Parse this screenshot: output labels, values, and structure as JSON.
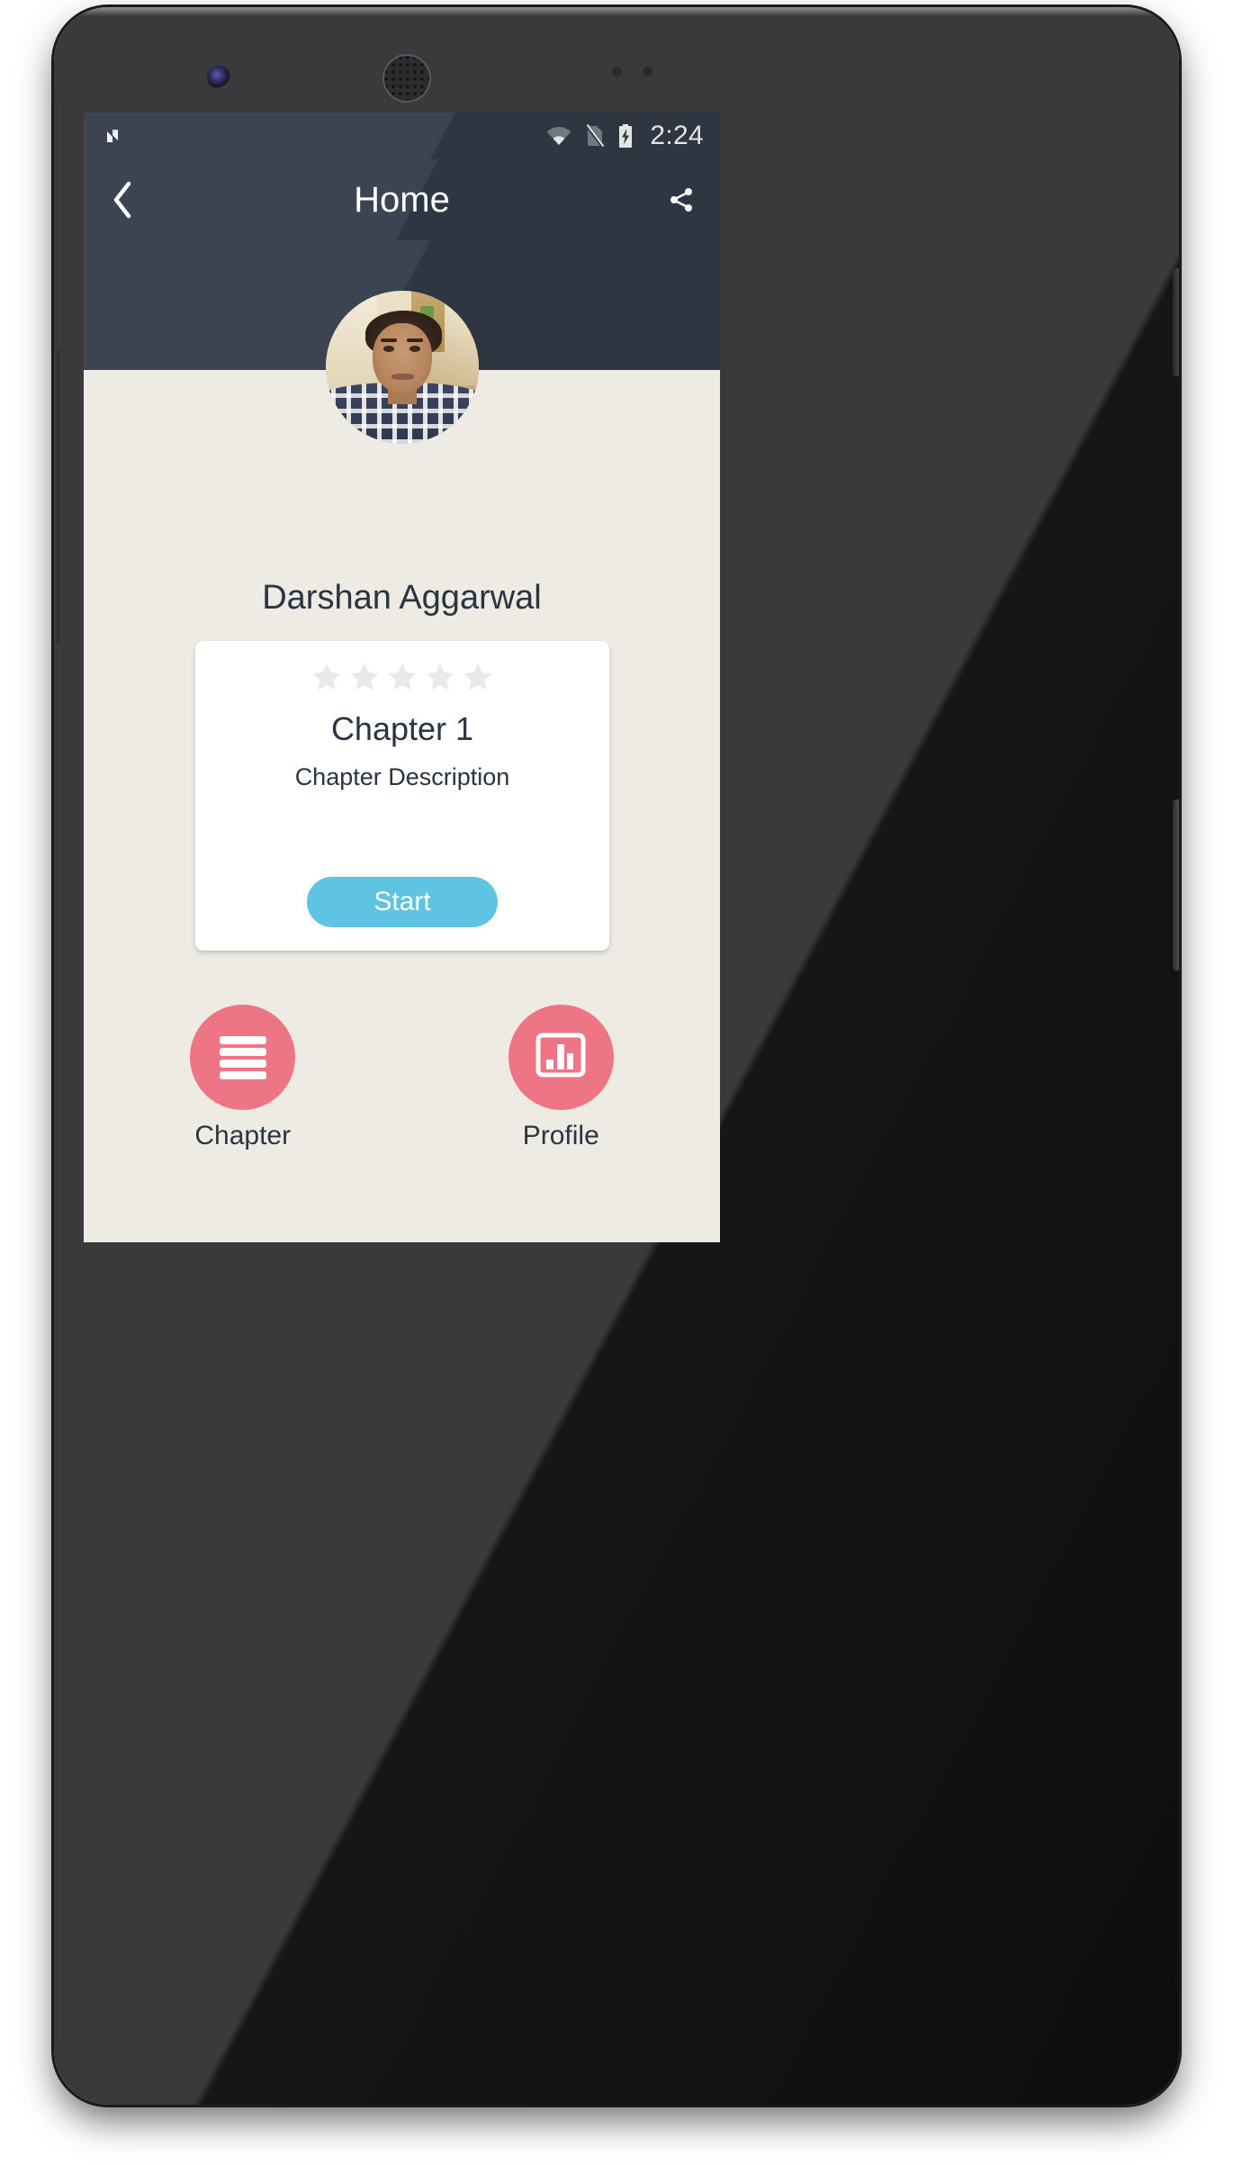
{
  "device": {
    "mockup_name": "android-phone-mockup",
    "camera_icon": "front-camera-icon",
    "speaker_icon": "earpiece-speaker-icon"
  },
  "status_bar": {
    "logo_icon": "android-n-logo-icon",
    "wifi_icon": "wifi-icon",
    "nosim_icon": "no-sim-icon",
    "battery_icon": "battery-charging-icon",
    "time": "2:24",
    "background_color": "#323C48"
  },
  "app_bar": {
    "back_icon": "chevron-left-icon",
    "title": "Home",
    "share_icon": "share-icon",
    "background_color": "#323C48",
    "title_color": "#FFFFFF"
  },
  "profile": {
    "avatar_icon": "user-avatar-photo",
    "name": "Darshan Aggarwal",
    "name_color": "#2B3441"
  },
  "chapter_card": {
    "rating": {
      "max": 5,
      "filled": 0,
      "star_icon": "star-icon",
      "empty_color": "#E9E9E9",
      "filled_color": "#FFC107"
    },
    "title": "Chapter 1",
    "description": "Chapter Description",
    "start_button": {
      "label": "Start",
      "color": "#5FC3E2",
      "text_color": "#FFFFFF"
    },
    "background_color": "#FFFFFF"
  },
  "actions": [
    {
      "label": "Chapter",
      "icon": "list-lines-icon",
      "color": "#EE7584"
    },
    {
      "label": "Profile",
      "icon": "bar-chart-icon",
      "color": "#EE7584"
    }
  ],
  "nav_bar": {
    "back_icon": "nav-back-triangle-icon",
    "home_icon": "nav-home-circle-icon",
    "recents_icon": "nav-recents-square-icon",
    "background_color": "#000000"
  },
  "theme": {
    "body_background": "#EDEBE4",
    "accent_pink": "#EE7584",
    "accent_blue": "#5FC3E2",
    "header_navy": "#323C48",
    "text_dark": "#2B3441"
  }
}
